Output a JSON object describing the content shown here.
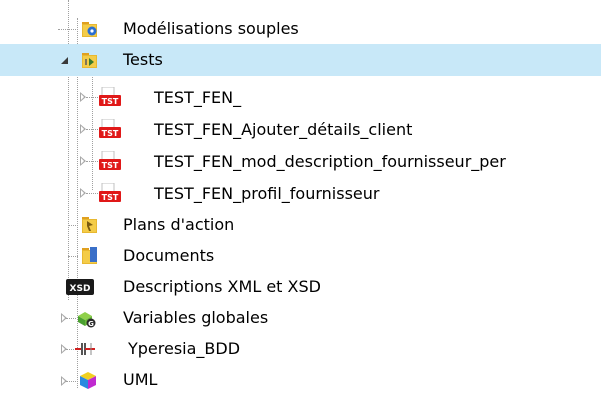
{
  "colors": {
    "selection": "#c8e8f8",
    "tree_lines": "#a0a0a0",
    "test_icon": "#e01818"
  },
  "tree": {
    "items": [
      {
        "label": "Modélisations souples",
        "icon": "folder-blue-gear-icon",
        "state": "leaf"
      },
      {
        "label": "Tests",
        "icon": "folder-test-icon",
        "state": "expanded",
        "selected": true
      },
      {
        "label": "TEST_FEN_",
        "icon": "tst-icon",
        "state": "collapsed"
      },
      {
        "label": "TEST_FEN_Ajouter_détails_client",
        "icon": "tst-icon",
        "state": "collapsed"
      },
      {
        "label": "TEST_FEN_mod_description_fournisseur_per",
        "icon": "tst-icon",
        "state": "collapsed"
      },
      {
        "label": "TEST_FEN_profil_fournisseur",
        "icon": "tst-icon",
        "state": "collapsed"
      },
      {
        "label": "Plans d'action",
        "icon": "folder-action-plans-icon",
        "state": "leaf"
      },
      {
        "label": "Documents",
        "icon": "folder-documents-icon",
        "state": "leaf"
      },
      {
        "label": "Descriptions XML et XSD",
        "icon": "xsd-icon",
        "icon_text": "XSD",
        "state": "leaf"
      },
      {
        "label": "Variables globales",
        "icon": "global-variables-icon",
        "icon_text": "G",
        "state": "collapsed"
      },
      {
        "label": "Yperesia_BDD",
        "icon": "database-connector-icon",
        "state": "collapsed"
      },
      {
        "label": "UML",
        "icon": "uml-cube-icon",
        "state": "collapsed"
      }
    ]
  }
}
